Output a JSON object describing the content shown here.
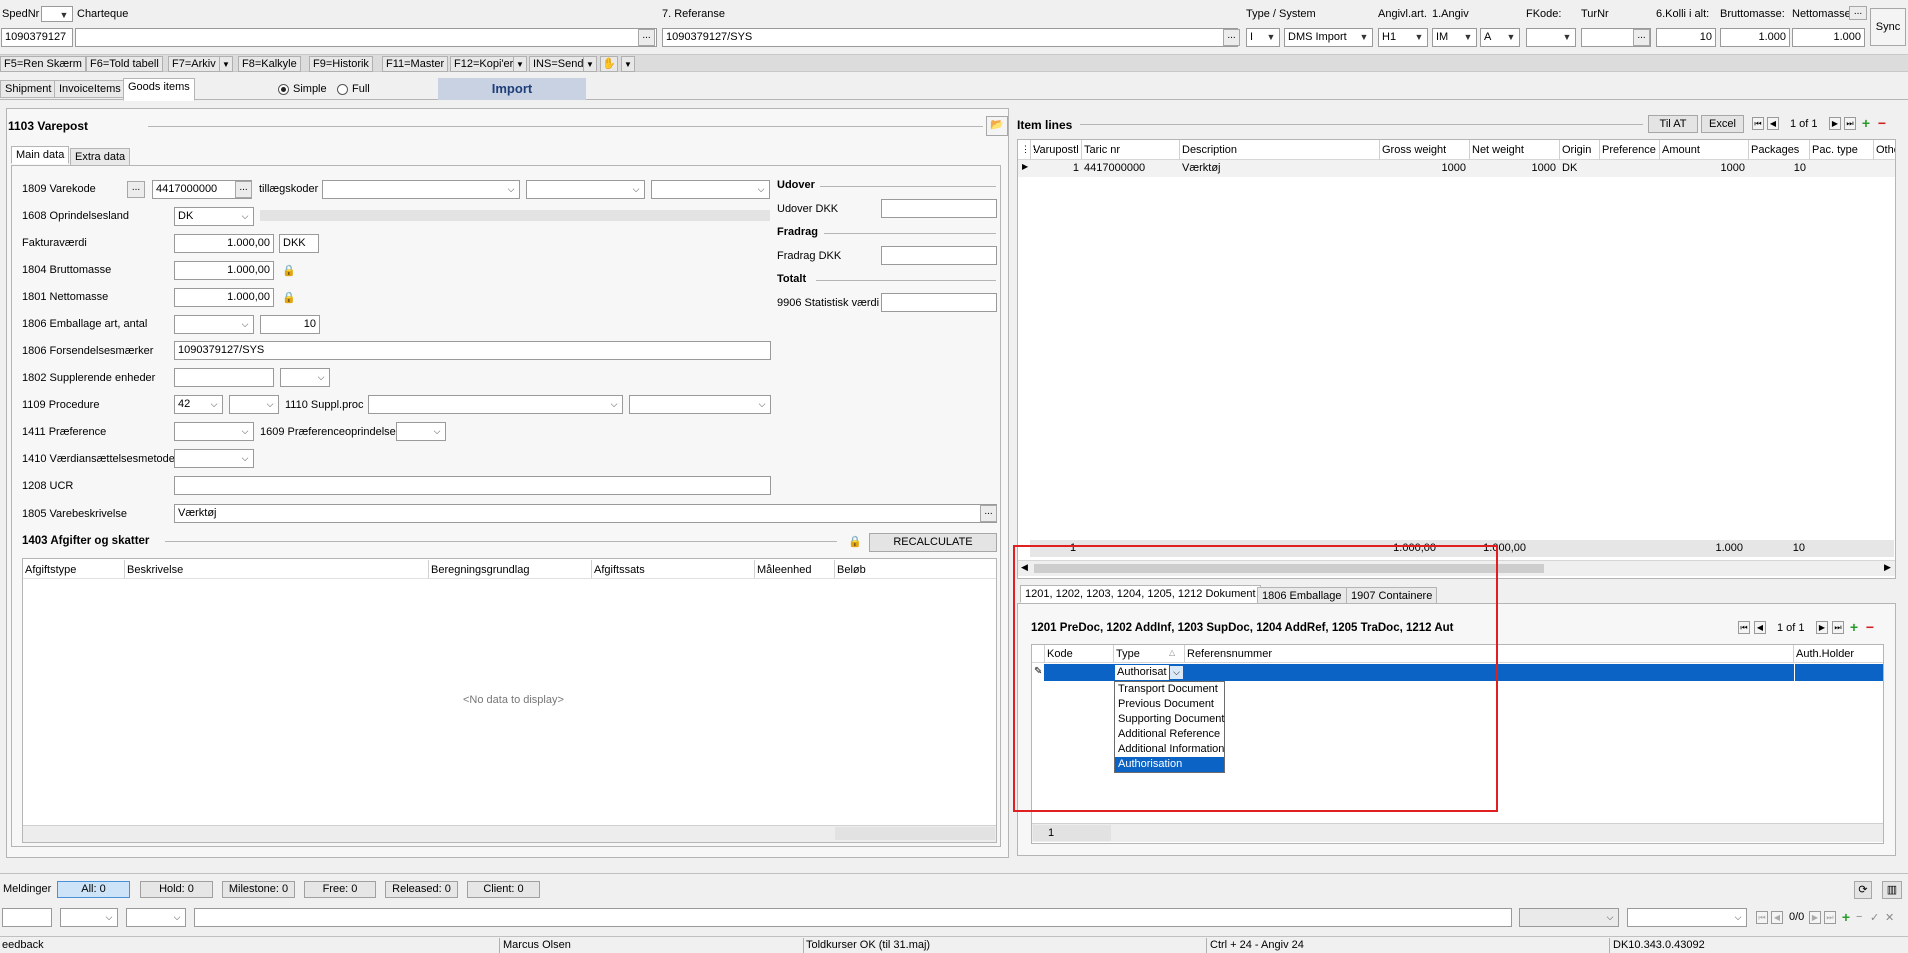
{
  "header": {
    "spednr_label": "SpedNr",
    "spednr_value": "1090379127",
    "charteque_label": "Charteque",
    "referanse_label": "7. Referanse",
    "referanse_value": "1090379127/SYS",
    "type_system_label": "Type / System",
    "type_value": "I",
    "system_value": "DMS Import",
    "angivl_art_label": "Angivl.art.",
    "angivl_art_value": "H1",
    "angiv1_label": "1.Angiv",
    "angiv1_value": "IM",
    "angiv1_sub": "A",
    "fkode_label": "FKode:",
    "turnr_label": "TurNr",
    "kolli_label": "6.Kolli i alt:",
    "kolli_value": "10",
    "brutto_label": "Bruttomasse:",
    "brutto_value": "1.000",
    "netto_label": "Nettomasse:",
    "netto_value": "1.000",
    "sync_label": "Sync",
    "dots": "..."
  },
  "toolbar": {
    "items": [
      "F5=Ren Skærm",
      "F6=Told tabell",
      "F7=Arkiv",
      "F8=Kalkyle",
      "F9=Historik",
      "F11=Master",
      "F12=Kopi'er",
      "INS=Send"
    ]
  },
  "main_tabs": [
    "Shipment",
    "InvoiceItems",
    "Goods items"
  ],
  "mode": {
    "simple": "Simple",
    "full": "Full"
  },
  "import_label": "Import",
  "varepost": {
    "title": "1103 Varepost",
    "tabs": [
      "Main data",
      "Extra data"
    ],
    "varekode_label": "1809 Varekode",
    "varekode_value": "4417000000",
    "tillaeg_label": "tillægskoder",
    "oprindelse_label": "1608 Oprindelsesland",
    "oprindelse_value": "DK",
    "faktura_label": "Fakturaværdi",
    "faktura_value": "1.000,00",
    "faktura_currency": "DKK",
    "brutto_label": "1804 Bruttomasse",
    "brutto_value": "1.000,00",
    "netto_label": "1801 Nettomasse",
    "netto_value": "1.000,00",
    "emballage_label": "1806 Emballage art, antal",
    "emballage_count": "10",
    "forsendelse_label": "1806 Forsendelsesmærker",
    "forsendelse_value": "1090379127/SYS",
    "suppl_label": "1802 Supplerende enheder",
    "procedure_label": "1109 Procedure",
    "procedure_value": "42",
    "suppl_proc_label": "1110 Suppl.proc",
    "praeference_label": "1411 Præference",
    "praef_oprind_label": "1609 Præferenceoprindelse",
    "vaerdi_metode_label": "1410 Værdiansættelsesmetode",
    "ucr_label": "1208 UCR",
    "varebeskrivelse_label": "1805 Varebeskrivelse",
    "varebeskrivelse_value": "Værktøj",
    "udover_title": "Udover",
    "udover_dkk_label": "Udover DKK",
    "fradrag_title": "Fradrag",
    "fradrag_dkk_label": "Fradrag DKK",
    "totalt_title": "Totalt",
    "statistisk_label": "9906 Statistisk værdi"
  },
  "afgifter": {
    "title": "1403 Afgifter og skatter",
    "recalc_label": "RECALCULATE",
    "columns": [
      "Afgiftstype",
      "Beskrivelse",
      "Beregningsgrundlag",
      "Afgiftssats",
      "Måleenhed",
      "Beløb"
    ],
    "empty": "<No data to display>"
  },
  "item_lines": {
    "title": "Item lines",
    "til_at": "Til AT",
    "excel": "Excel",
    "pager": "1 of 1",
    "columns": [
      "Varupostl",
      "Taric nr",
      "Description",
      "Gross weight",
      "Net weight",
      "Origin",
      "Preference",
      "Amount",
      "Packages",
      "Pac. type",
      "Othe"
    ],
    "rows": [
      {
        "varupost": "1",
        "taric": "4417000000",
        "description": "Værktøj",
        "gross": "1000",
        "net": "1000",
        "origin": "DK",
        "preference": "",
        "amount": "1000",
        "packages": "10",
        "pactype": ""
      }
    ],
    "totals": {
      "count": "1",
      "gross": "1.000,00",
      "net": "1.000,00",
      "amount": "1.000",
      "packages": "10"
    }
  },
  "docs": {
    "tabs": [
      "1201, 1202, 1203, 1204, 1205, 1212 Dokument",
      "1806 Emballage",
      "1907 Containere"
    ],
    "title": "1201 PreDoc, 1202 AddInf, 1203 SupDoc, 1204 AddRef, 1205 TraDoc, 1212 Aut",
    "pager": "1 of 1",
    "columns": [
      "Kode",
      "Type",
      "Referensnummer",
      "Auth.Holder"
    ],
    "type_value": "Authorisat",
    "options": [
      "Transport Document",
      "Previous Document",
      "Supporting Document",
      "Additional Reference",
      "Additional Information",
      "Authorisation"
    ],
    "selected_option": "Authorisation",
    "footer_count": "1"
  },
  "meldinger": {
    "label": "Meldinger",
    "buttons": [
      "All: 0",
      "Hold: 0",
      "Milestone: 0",
      "Free: 0",
      "Released: 0",
      "Client: 0"
    ],
    "pager": "0/0"
  },
  "statusbar": {
    "feedback": "eedback",
    "user": "Marcus Olsen",
    "toldkurser": "Toldkurser OK (til 31.maj)",
    "shortcut": "Ctrl + 24 - Angiv 24",
    "version": "DK10.343.0.43092"
  },
  "colors": {
    "accent": "#0b63c5",
    "import_header": "#1f3f7a",
    "highlight_box": "#e02020"
  }
}
